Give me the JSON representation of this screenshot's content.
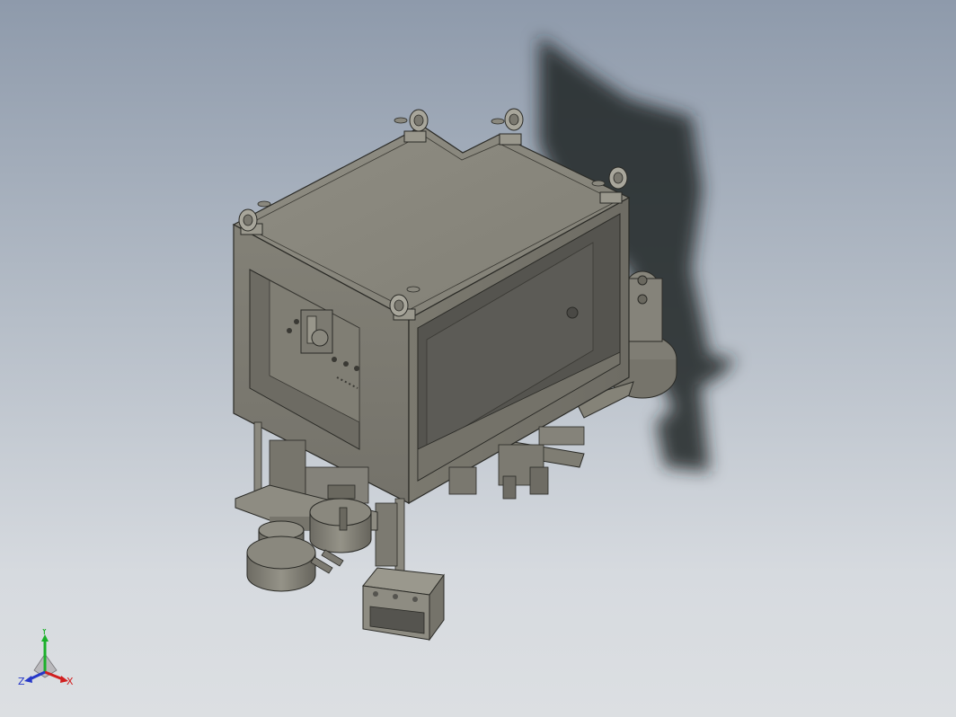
{
  "viewport": {
    "background_top": "#8e9aab",
    "background_bottom": "#dcdfe2"
  },
  "model": {
    "body_color": "#8d8b80",
    "shadow_color": "#1f2326"
  },
  "triad": {
    "x_label": "X",
    "y_label": "Y",
    "z_label": "Z",
    "x_color": "#d11f1f",
    "y_color": "#1bb02a",
    "z_color": "#2638c8"
  }
}
